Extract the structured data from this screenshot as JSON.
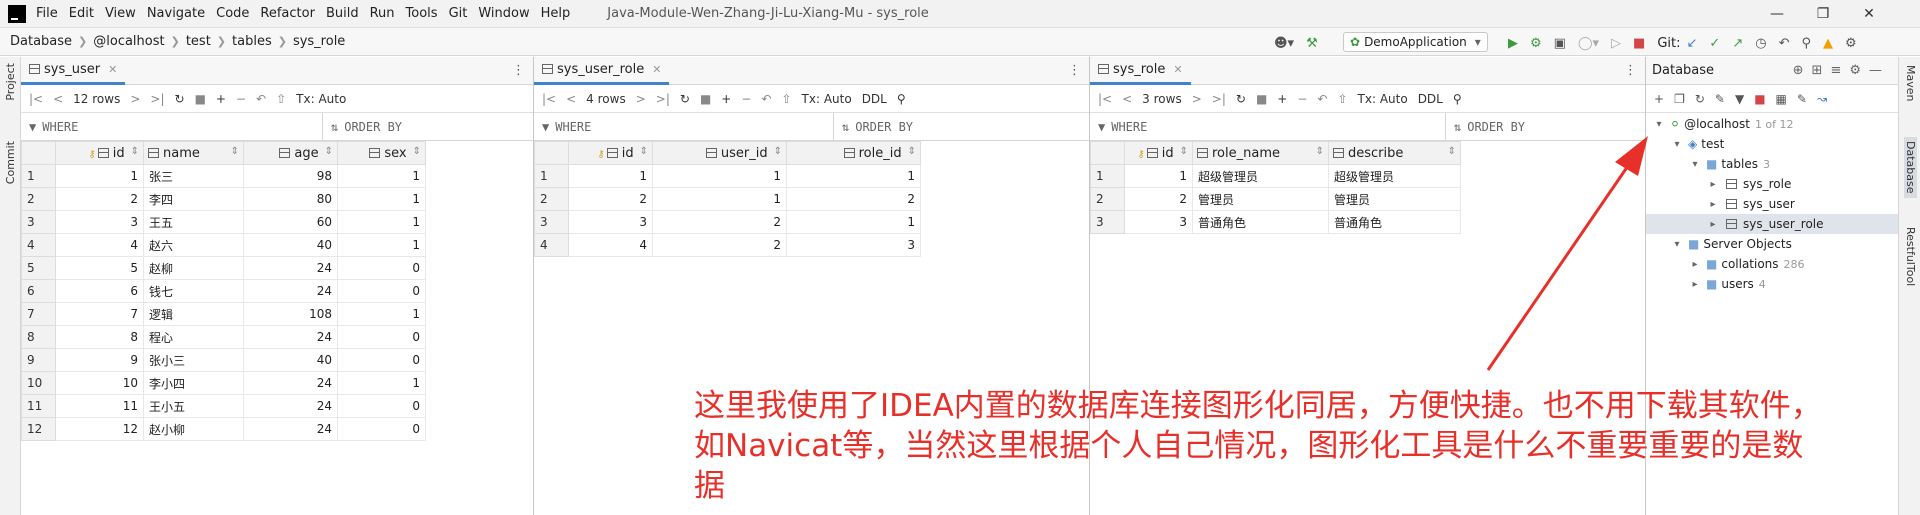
{
  "menubar": {
    "items": [
      "File",
      "Edit",
      "View",
      "Navigate",
      "Code",
      "Refactor",
      "Build",
      "Run",
      "Tools",
      "Git",
      "Window",
      "Help"
    ],
    "window_title": "Java-Module-Wen-Zhang-Ji-Lu-Xiang-Mu - sys_role"
  },
  "breadcrumb": [
    "Database",
    "@localhost",
    "test",
    "tables",
    "sys_role"
  ],
  "run_config": "DemoApplication",
  "git_label": "Git:",
  "panels": [
    {
      "tab": "sys_user",
      "rows_label": "12 rows",
      "tx": "Tx: Auto",
      "where": "WHERE",
      "orderby": "ORDER BY",
      "columns": [
        "id",
        "name",
        "age",
        "sex"
      ],
      "rows": [
        [
          "1",
          "1",
          "张三",
          "98",
          "1"
        ],
        [
          "2",
          "2",
          "李四",
          "80",
          "1"
        ],
        [
          "3",
          "3",
          "王五",
          "60",
          "1"
        ],
        [
          "4",
          "4",
          "赵六",
          "40",
          "1"
        ],
        [
          "5",
          "5",
          "赵柳",
          "24",
          "0"
        ],
        [
          "6",
          "6",
          "钱七",
          "24",
          "0"
        ],
        [
          "7",
          "7",
          "逻辑",
          "108",
          "1"
        ],
        [
          "8",
          "8",
          "程心",
          "24",
          "0"
        ],
        [
          "9",
          "9",
          "张小三",
          "40",
          "0"
        ],
        [
          "10",
          "10",
          "李小四",
          "24",
          "1"
        ],
        [
          "11",
          "11",
          "王小五",
          "24",
          "0"
        ],
        [
          "12",
          "12",
          "赵小柳",
          "24",
          "0"
        ]
      ]
    },
    {
      "tab": "sys_user_role",
      "rows_label": "4 rows",
      "tx": "Tx: Auto",
      "ddl": "DDL",
      "where": "WHERE",
      "orderby": "ORDER BY",
      "columns": [
        "id",
        "user_id",
        "role_id"
      ],
      "rows": [
        [
          "1",
          "1",
          "1",
          "1"
        ],
        [
          "2",
          "2",
          "1",
          "2"
        ],
        [
          "3",
          "3",
          "2",
          "1"
        ],
        [
          "4",
          "4",
          "2",
          "3"
        ]
      ]
    },
    {
      "tab": "sys_role",
      "rows_label": "3 rows",
      "tx": "Tx: Auto",
      "ddl": "DDL",
      "where": "WHERE",
      "orderby": "ORDER BY",
      "columns": [
        "id",
        "role_name",
        "describe"
      ],
      "rows": [
        [
          "1",
          "1",
          "超级管理员",
          "超级管理员"
        ],
        [
          "2",
          "2",
          "管理员",
          "管理员"
        ],
        [
          "3",
          "3",
          "普通角色",
          "普通角色"
        ]
      ]
    }
  ],
  "database": {
    "title": "Database",
    "host": "@localhost",
    "host_count": "1 of 12",
    "schema": "test",
    "tables_label": "tables",
    "tables_count": "3",
    "tables": [
      "sys_role",
      "sys_user",
      "sys_user_role"
    ],
    "server_objects": "Server Objects",
    "collations": "collations",
    "collations_count": "286",
    "users": "users",
    "users_count": "4"
  },
  "left_strip": [
    "Project",
    "Commit"
  ],
  "right_strip": [
    "Maven",
    "Database",
    "RestfulTool"
  ],
  "annotation": "这里我使用了IDEA内置的数据库连接图形化同居，方便快捷。也不用下载其软件，如Navicat等，当然这里根据个人自己情况，图形化工具是什么不重要重要的是数据",
  "colors": {
    "accent": "#4083c9",
    "annotation": "#e8302a",
    "run": "#3e9b3e",
    "stop": "#d64545"
  }
}
